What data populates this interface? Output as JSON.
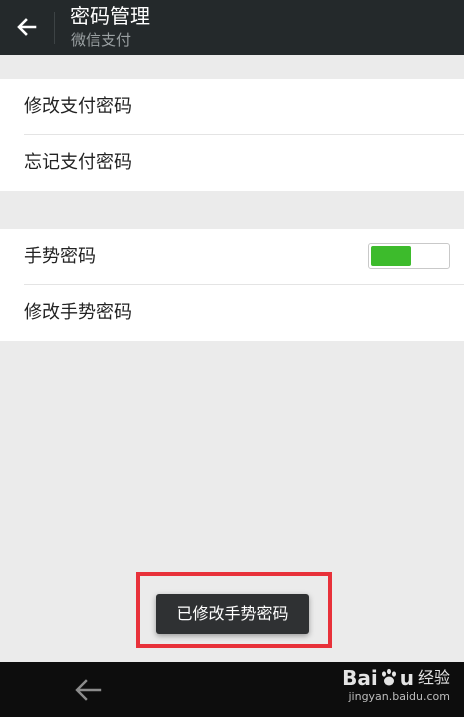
{
  "header": {
    "title": "密码管理",
    "subtitle": "微信支付",
    "back_icon": "arrow-left-icon"
  },
  "payment_group": {
    "items": [
      {
        "label": "修改支付密码"
      },
      {
        "label": "忘记支付密码"
      }
    ]
  },
  "gesture_group": {
    "gesture_toggle": {
      "label": "手势密码",
      "state": "on",
      "on_color": "#3dbb2c"
    },
    "modify_gesture": {
      "label": "修改手势密码"
    }
  },
  "toast": {
    "text": "已修改手势密码",
    "highlight_color": "#e8313a"
  },
  "navbar": {
    "back_icon": "arrow-left-icon"
  },
  "watermark": {
    "brand_left": "Bai",
    "brand_right": "u",
    "suffix": "经验",
    "domain": "jingyan.baidu.com"
  }
}
